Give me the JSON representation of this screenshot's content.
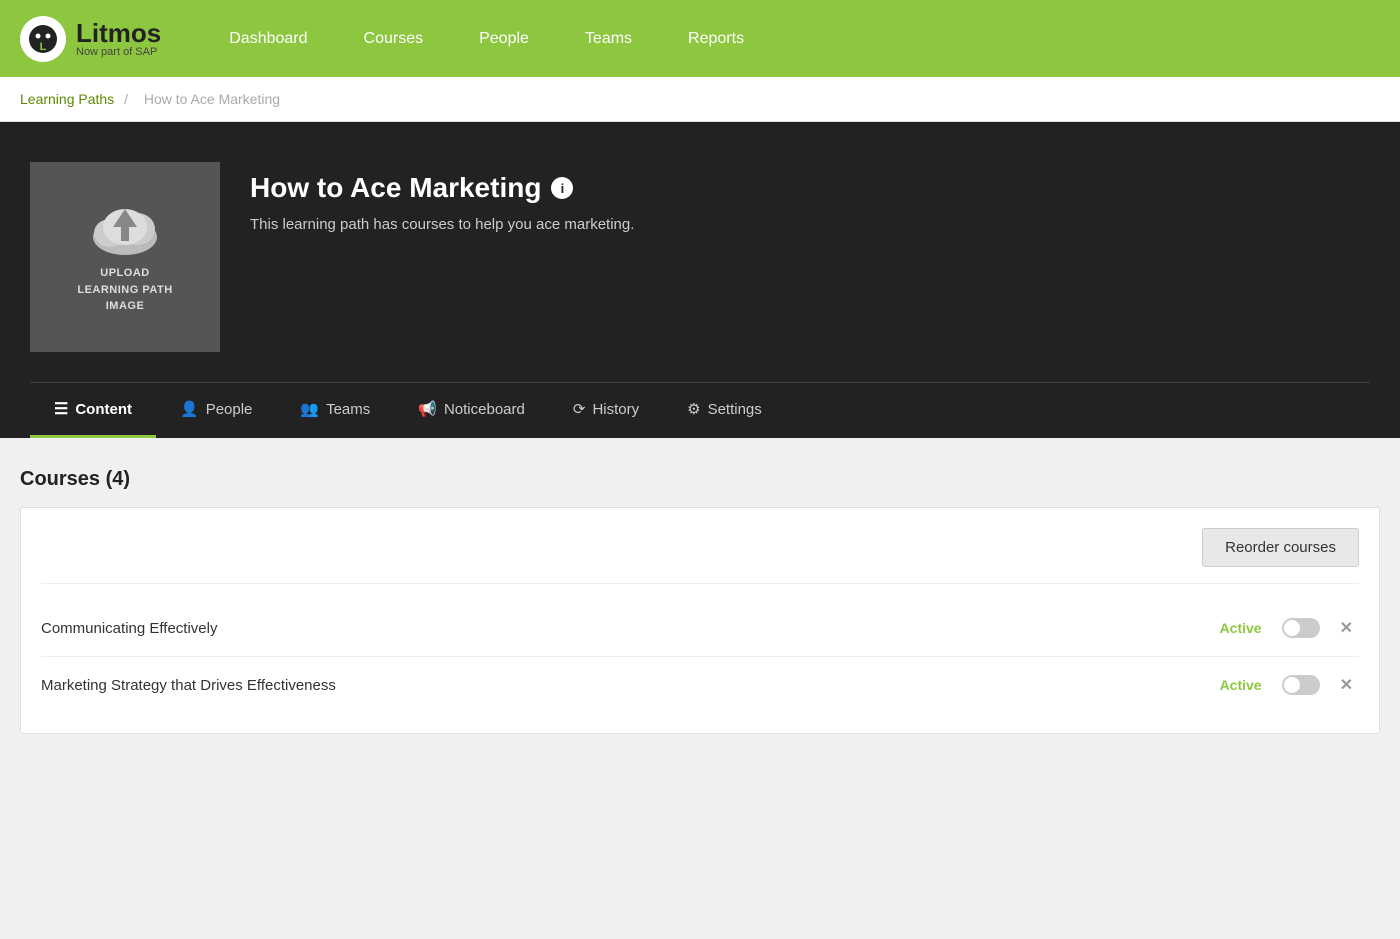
{
  "nav": {
    "logo_title": "Litmos",
    "logo_sub": "Now part of SAP",
    "links": [
      {
        "label": "Dashboard",
        "id": "dashboard"
      },
      {
        "label": "Courses",
        "id": "courses"
      },
      {
        "label": "People",
        "id": "people"
      },
      {
        "label": "Teams",
        "id": "teams"
      },
      {
        "label": "Reports",
        "id": "reports"
      }
    ]
  },
  "breadcrumb": {
    "parent_label": "Learning Paths",
    "separator": "/",
    "current": "How to Ace Marketing"
  },
  "hero": {
    "upload_label": "UPLOAD\nLEARNING PATH\nIMAGE",
    "title": "How to Ace Marketing",
    "description": "This learning path has courses to help you ace marketing.",
    "info_icon": "i"
  },
  "tabs": [
    {
      "id": "content",
      "icon": "list",
      "label": "Content",
      "active": true
    },
    {
      "id": "people",
      "icon": "person",
      "label": "People",
      "active": false
    },
    {
      "id": "teams",
      "icon": "team",
      "label": "Teams",
      "active": false
    },
    {
      "id": "noticeboard",
      "icon": "megaphone",
      "label": "Noticeboard",
      "active": false
    },
    {
      "id": "history",
      "icon": "history",
      "label": "History",
      "active": false
    },
    {
      "id": "settings",
      "icon": "gear",
      "label": "Settings",
      "active": false
    }
  ],
  "courses_section": {
    "title": "Courses (4)",
    "reorder_label": "Reorder courses",
    "courses": [
      {
        "name": "Communicating Effectively",
        "status": "Active"
      },
      {
        "name": "Marketing Strategy that Drives Effectiveness",
        "status": "Active"
      }
    ]
  },
  "colors": {
    "green": "#8dc63f",
    "dark": "#222",
    "status_green": "#8dc63f"
  }
}
